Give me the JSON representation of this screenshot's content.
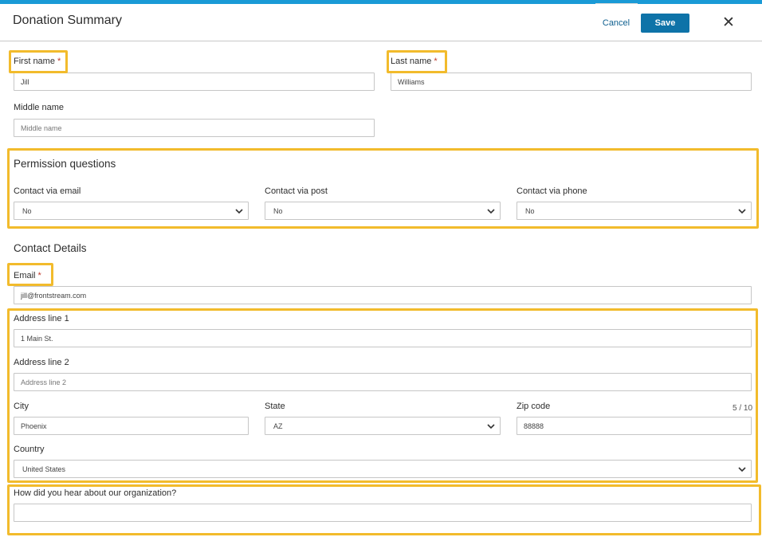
{
  "header": {
    "title": "Donation Summary",
    "cancel_label": "Cancel",
    "save_label": "Save",
    "close_symbol": "✕"
  },
  "name": {
    "first_label": "First name",
    "first_value": "Jill",
    "last_label": "Last name",
    "last_value": "Williams",
    "middle_label": "Middle name",
    "middle_placeholder": "Middle name",
    "required_mark": "*"
  },
  "permissions": {
    "title": "Permission questions",
    "email_label": "Contact via email",
    "email_value": "No",
    "post_label": "Contact via post",
    "post_value": "No",
    "phone_label": "Contact via phone",
    "phone_value": "No"
  },
  "contact": {
    "title": "Contact Details",
    "email_label": "Email",
    "email_value": "jill@frontstream.com",
    "address1_label": "Address line 1",
    "address1_value": "1 Main St.",
    "address2_label": "Address line 2",
    "address2_placeholder": "Address line 2",
    "city_label": "City",
    "city_value": "Phoenix",
    "state_label": "State",
    "state_value": "AZ",
    "zip_label": "Zip code",
    "zip_value": "88888",
    "zip_counter": "5 / 10",
    "country_label": "Country",
    "country_value": "United States"
  },
  "referral": {
    "label": "How did you hear about our organization?",
    "value": ""
  },
  "colors": {
    "accent_bar": "#1a9ad6",
    "save_button": "#0e73a8",
    "highlight": "#f2bb2c",
    "required": "#c0392b"
  },
  "icons": {
    "close": "close-icon",
    "dropdown": "chevron-down-icon"
  }
}
